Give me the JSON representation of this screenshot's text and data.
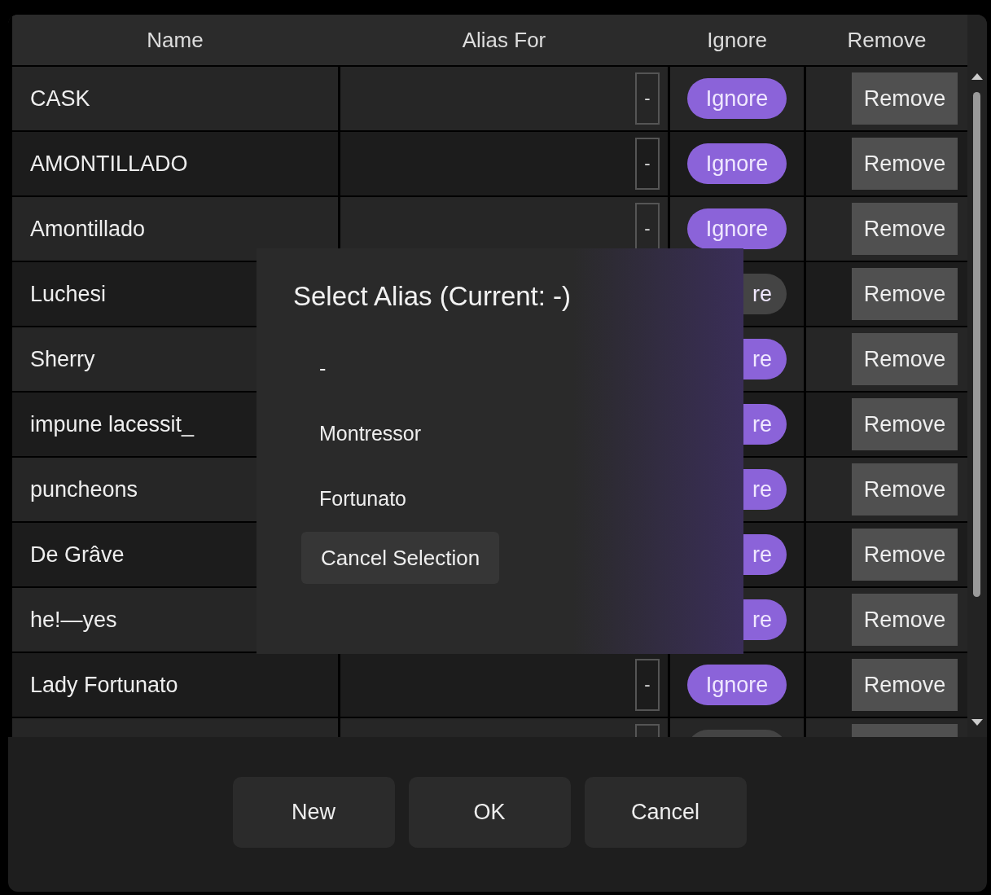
{
  "table": {
    "columns": [
      "Name",
      "Alias For",
      "Ignore",
      "Remove"
    ],
    "rows": [
      {
        "name": "CASK",
        "alias": "-",
        "ignore_label": "Ignore",
        "ignored": true,
        "remove_label": "Remove"
      },
      {
        "name": "AMONTILLADO",
        "alias": "-",
        "ignore_label": "Ignore",
        "ignored": true,
        "remove_label": "Remove"
      },
      {
        "name": "Amontillado",
        "alias": "-",
        "ignore_label": "Ignore",
        "ignored": true,
        "remove_label": "Remove"
      },
      {
        "name": "Luchesi",
        "ignore_label": "re",
        "ignored": false,
        "remove_label": "Remove"
      },
      {
        "name": "Sherry",
        "ignore_label": "re",
        "ignored": true,
        "remove_label": "Remove"
      },
      {
        "name": "impune lacessit_",
        "ignore_label": "re",
        "ignored": true,
        "remove_label": "Remove"
      },
      {
        "name": "puncheons",
        "ignore_label": "re",
        "ignored": true,
        "remove_label": "Remove"
      },
      {
        "name": "De Grâve",
        "ignore_label": "re",
        "ignored": true,
        "remove_label": "Remove"
      },
      {
        "name": "he!—yes",
        "ignore_label": "re",
        "ignored": true,
        "remove_label": "Remove"
      },
      {
        "name": "Lady Fortunato",
        "alias": "-",
        "ignore_label": "Ignore",
        "ignored": true,
        "remove_label": "Remove"
      },
      {
        "ignored": false
      }
    ]
  },
  "alias_popup": {
    "title": "Select Alias (Current: -)",
    "options": [
      "-",
      "Montressor",
      "Fortunato"
    ],
    "cancel_label": "Cancel Selection"
  },
  "buttons": [
    "New",
    "OK",
    "Cancel"
  ]
}
